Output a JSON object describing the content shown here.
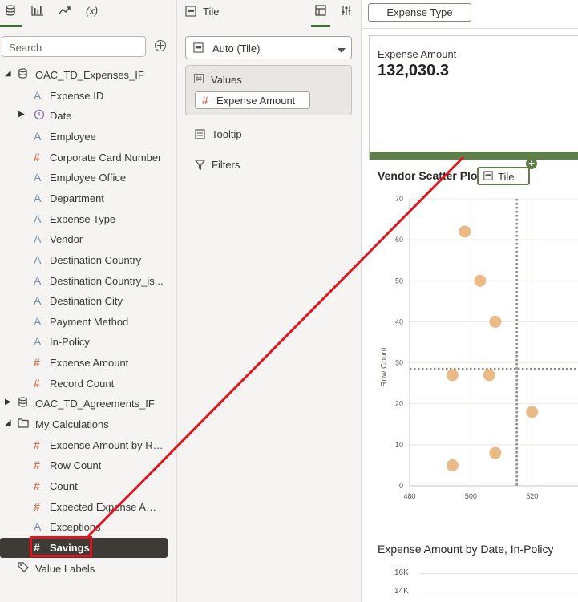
{
  "left_panel": {
    "tab_icons": [
      "database-icon",
      "bar-chart-icon",
      "trend-icon",
      "function-icon"
    ],
    "function_tab_label": "(x)",
    "search_placeholder": "Search",
    "tree": [
      {
        "label": "OAC_TD_Expenses_IF",
        "type": "folder",
        "expanded": true
      },
      {
        "label": "Expense ID",
        "type": "text"
      },
      {
        "label": "Date",
        "type": "date"
      },
      {
        "label": "Employee",
        "type": "text"
      },
      {
        "label": "Corporate Card Number",
        "type": "number"
      },
      {
        "label": "Employee Office",
        "type": "text"
      },
      {
        "label": "Department",
        "type": "text"
      },
      {
        "label": "Expense Type",
        "type": "text"
      },
      {
        "label": "Vendor",
        "type": "text"
      },
      {
        "label": "Destination Country",
        "type": "text"
      },
      {
        "label": "Destination Country_is...",
        "type": "text"
      },
      {
        "label": "Destination City",
        "type": "text"
      },
      {
        "label": "Payment Method",
        "type": "text"
      },
      {
        "label": "In-Policy",
        "type": "text"
      },
      {
        "label": "Expense Amount",
        "type": "number"
      },
      {
        "label": "Record Count",
        "type": "number"
      },
      {
        "label": "OAC_TD_Agreements_IF",
        "type": "folder",
        "expanded": false
      },
      {
        "label": "My Calculations",
        "type": "folder",
        "expanded": true
      },
      {
        "label": "Expense Amount by Re...",
        "type": "number"
      },
      {
        "label": "Row Count",
        "type": "number"
      },
      {
        "label": "Count",
        "type": "number"
      },
      {
        "label": "Expected Expense Amo...",
        "type": "number"
      },
      {
        "label": "Exceptions",
        "type": "text"
      },
      {
        "label": "Savings",
        "type": "number",
        "selected": true
      },
      {
        "label": "Value Labels",
        "type": "tag"
      }
    ]
  },
  "middle_panel": {
    "tab_label": "Tile",
    "viz_type": "Auto (Tile)",
    "values_label": "Values",
    "values_pill": "Expense Amount",
    "tooltip_label": "Tooltip",
    "filters_label": "Filters"
  },
  "canvas": {
    "filter_tab": "Expense Type",
    "tile": {
      "label": "Expense Amount",
      "value": "132,030.3"
    },
    "drag_chip": "Tile",
    "scatter_title": "Vendor Scatter Plo",
    "line_title": "Expense Amount by Date, In-Policy",
    "line_ticks": [
      "16K",
      "14K"
    ],
    "colors": {
      "accent": "#5f7f4a",
      "points": "#ecba86",
      "drag_line": "#e1141e"
    }
  },
  "chart_data": {
    "type": "scatter",
    "title": "Vendor Scatter Plo",
    "ylabel": "Row Count",
    "xlabel": "",
    "xlim": [
      480,
      535
    ],
    "ylim": [
      0,
      70
    ],
    "x_ticks": [
      480,
      500,
      520
    ],
    "y_ticks": [
      0,
      10,
      20,
      30,
      40,
      50,
      60,
      70
    ],
    "reference_lines": {
      "x": 515,
      "y": 28.5
    },
    "points": [
      {
        "x": 498,
        "y": 62
      },
      {
        "x": 503,
        "y": 50
      },
      {
        "x": 508,
        "y": 40
      },
      {
        "x": 494,
        "y": 27
      },
      {
        "x": 506,
        "y": 27
      },
      {
        "x": 520,
        "y": 18
      },
      {
        "x": 494,
        "y": 5
      },
      {
        "x": 508,
        "y": 8
      }
    ]
  }
}
